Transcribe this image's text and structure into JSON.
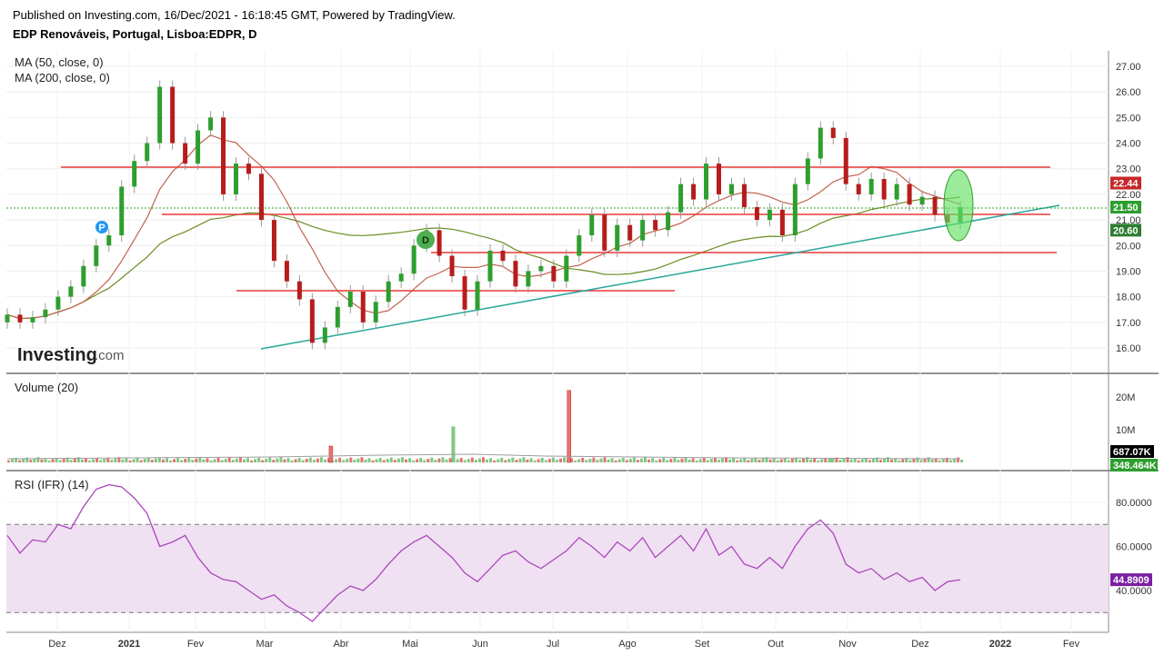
{
  "header": {
    "published": "Published on Investing.com, 16/Dec/2021 - 16:18:45 GMT, Powered by TradingView.",
    "symbol": "EDP Renováveis, Portugal, Lisboa:EDPR, D"
  },
  "logo": {
    "main": "Investing",
    "suffix": ".com"
  },
  "chart_data": [
    {
      "type": "candlestick",
      "indicators": [
        "MA (50, close, 0)",
        "MA (200, close, 0)"
      ],
      "x_ticks": [
        "Dez",
        "2021",
        "Fev",
        "Mar",
        "Abr",
        "Mai",
        "Jun",
        "Jul",
        "Ago",
        "Set",
        "Out",
        "Nov",
        "Dez",
        "2022",
        "Fev"
      ],
      "y_ticks": [
        "27.00",
        "26.00",
        "25.00",
        "24.00",
        "23.00",
        "22.00",
        "21.00",
        "20.00",
        "19.00",
        "18.00",
        "17.00",
        "16.00"
      ],
      "ylim": [
        15.2,
        27.2
      ],
      "price_tags": [
        {
          "label": "22.44",
          "value": 22.44,
          "color": "#c62828"
        },
        {
          "label": "21.50",
          "value": 21.5,
          "color": "#2e9e2e"
        },
        {
          "label": "20.60",
          "value": 20.6,
          "color": "#2e7d32"
        }
      ],
      "markers": [
        "P",
        "D"
      ],
      "close_series": [
        17.3,
        17.0,
        17.2,
        17.5,
        18.0,
        18.4,
        19.2,
        20.0,
        20.4,
        22.3,
        23.3,
        24.0,
        26.2,
        24.0,
        23.2,
        24.5,
        25.0,
        22.0,
        23.2,
        22.8,
        21.0,
        19.4,
        18.6,
        17.9,
        16.2,
        16.8,
        17.6,
        18.2,
        17.0,
        17.8,
        18.6,
        18.9,
        20.0,
        20.6,
        19.6,
        18.8,
        17.5,
        18.6,
        19.8,
        19.4,
        18.4,
        19.0,
        19.2,
        18.6,
        19.6,
        20.4,
        21.2,
        19.8,
        20.8,
        20.2,
        21.0,
        20.6,
        21.3,
        22.4,
        21.8,
        23.2,
        22.0,
        22.4,
        21.5,
        21.0,
        21.4,
        20.4,
        22.4,
        23.4,
        24.6,
        24.2,
        22.4,
        22.0,
        22.6,
        21.8,
        22.4,
        21.6,
        21.9,
        21.2,
        20.9,
        21.5
      ]
    },
    {
      "type": "bar",
      "title": "Volume (20)",
      "y_ticks": [
        "20M",
        "10M"
      ],
      "ylim": [
        0,
        25
      ],
      "price_tags": [
        {
          "label": "687.07K",
          "color": "#000000"
        },
        {
          "label": "348.464K",
          "color": "#2e9e2e"
        }
      ],
      "spikes": [
        {
          "position": 0.292,
          "value": 5.0,
          "color": "#e57373"
        },
        {
          "position": 0.403,
          "value": 11.0,
          "color": "#81c784"
        },
        {
          "position": 0.508,
          "value": 22.0,
          "color": "#e57373"
        },
        {
          "position": 0.745,
          "value": 1.2,
          "color": "#81c784"
        }
      ]
    },
    {
      "type": "line",
      "title": "RSI (IFR) (14)",
      "y_ticks": [
        "80.0000",
        "60.0000",
        "40.0000"
      ],
      "ylim": [
        22,
        90
      ],
      "band": [
        30,
        70
      ],
      "last_value": "44.8909",
      "values": [
        65,
        57,
        63,
        62,
        70,
        68,
        78,
        86,
        88,
        87,
        82,
        75,
        60,
        62,
        65,
        55,
        48,
        45,
        44,
        40,
        36,
        38,
        33,
        30,
        26,
        32,
        38,
        42,
        40,
        45,
        52,
        58,
        62,
        65,
        60,
        55,
        48,
        44,
        50,
        56,
        58,
        53,
        50,
        54,
        58,
        64,
        60,
        55,
        62,
        58,
        64,
        55,
        60,
        65,
        58,
        68,
        56,
        60,
        52,
        50,
        55,
        50,
        60,
        68,
        72,
        66,
        52,
        48,
        50,
        45,
        48,
        44,
        46,
        40,
        44,
        44.9
      ]
    }
  ]
}
